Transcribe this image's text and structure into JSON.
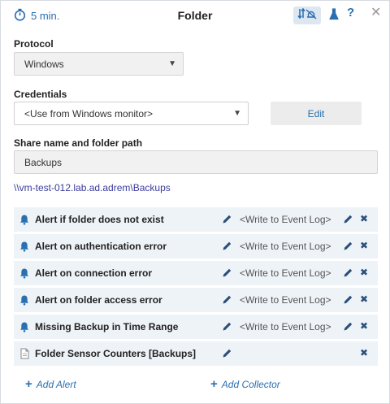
{
  "header": {
    "interval": "5 min.",
    "title": "Folder",
    "help_glyph": "?",
    "close_glyph": "✕",
    "icons": [
      "stopwatch-icon",
      "sort-alerts-off-icon",
      "flask-icon",
      "help-icon",
      "close-icon"
    ]
  },
  "protocol": {
    "label": "Protocol",
    "value": "Windows"
  },
  "credentials": {
    "label": "Credentials",
    "value": "<Use from Windows monitor>",
    "edit_label": "Edit"
  },
  "share": {
    "label": "Share name and folder path",
    "value": "Backups",
    "resolved_path": "\\\\vm-test-012.lab.ad.adrem\\Backups"
  },
  "rows": [
    {
      "icon": "bell-icon",
      "name": "Alert if folder does not exist",
      "target": "<Write to Event Log>"
    },
    {
      "icon": "bell-icon",
      "name": "Alert on authentication error",
      "target": "<Write to Event Log>"
    },
    {
      "icon": "bell-icon",
      "name": "Alert on connection error",
      "target": "<Write to Event Log>"
    },
    {
      "icon": "bell-icon",
      "name": "Alert on folder access error",
      "target": "<Write to Event Log>"
    },
    {
      "icon": "bell-icon",
      "name": "Missing Backup in Time Range",
      "target": "<Write to Event Log>"
    },
    {
      "icon": "document-icon",
      "name": "Folder Sensor Counters [Backups]",
      "target": ""
    }
  ],
  "footer": {
    "add_alert": "Add Alert",
    "add_collector": "Add Collector"
  },
  "colors": {
    "accent": "#2a6fb0",
    "row_bg": "#eef3f8",
    "path_link": "#3b3b9e"
  }
}
